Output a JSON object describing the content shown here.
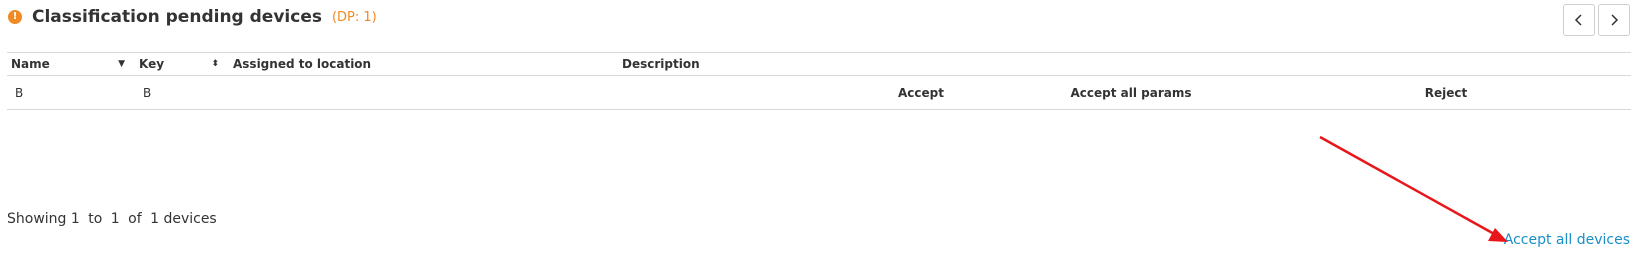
{
  "header": {
    "title": "Classification pending devices",
    "dp_badge": "(DP: 1)",
    "warning_icon": "exclamation-circle-icon",
    "warning_color": "#f08a24"
  },
  "pager": {
    "prev_icon": "chevron-left-icon",
    "next_icon": "chevron-right-icon"
  },
  "table": {
    "columns": [
      "Name",
      "Key",
      "Assigned to location",
      "Description"
    ],
    "rows": [
      {
        "name": "B",
        "key": "B",
        "location": "",
        "description": "",
        "accept": "Accept",
        "accept_params": "Accept all params",
        "reject": "Reject"
      }
    ]
  },
  "footer": {
    "showing": [
      "Showing 1",
      "to",
      "1",
      "of",
      "1 devices"
    ],
    "accept_all": "Accept all devices"
  },
  "colors": {
    "link": "#1a8fc7",
    "accent": "#f08a24",
    "annotation": "#e8161a"
  }
}
